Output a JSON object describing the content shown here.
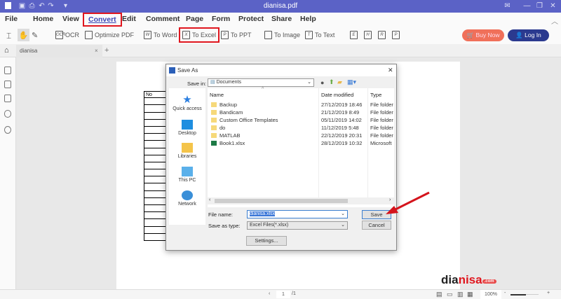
{
  "window": {
    "title": "dianisa.pdf"
  },
  "menu": [
    "File",
    "Home",
    "View",
    "Convert",
    "Edit",
    "Comment",
    "Page",
    "Form",
    "Protect",
    "Share",
    "Help"
  ],
  "toolbar": {
    "ocr": "OCR",
    "optimize": "Optimize PDF",
    "to_word": "To Word",
    "to_excel": "To Excel",
    "to_ppt": "To PPT",
    "to_image": "To Image",
    "to_text": "To Text",
    "extra": [
      "E",
      "H",
      "R",
      "P"
    ],
    "buy_now": "Buy Now",
    "log_in": "Log In"
  },
  "tabs": [
    {
      "label": "dianisa"
    }
  ],
  "document": {
    "table_header": "No"
  },
  "dialog": {
    "title": "Save As",
    "save_in_label": "Save in:",
    "save_in_value": "Documents",
    "places": [
      "Quick access",
      "Desktop",
      "Libraries",
      "This PC",
      "Network"
    ],
    "columns": [
      "Name",
      "Date modified",
      "Type"
    ],
    "files": [
      {
        "name": "Backup",
        "date": "27/12/2019 18:46",
        "type": "File folder",
        "kind": "folder"
      },
      {
        "name": "Bandicam",
        "date": "21/12/2019 8:49",
        "type": "File folder",
        "kind": "folder"
      },
      {
        "name": "Custom Office Templates",
        "date": "05/11/2019 14:02",
        "type": "File folder",
        "kind": "folder"
      },
      {
        "name": "do",
        "date": "11/12/2019 5:48",
        "type": "File folder",
        "kind": "folder"
      },
      {
        "name": "MATLAB",
        "date": "22/12/2019 20:31",
        "type": "File folder",
        "kind": "folder"
      },
      {
        "name": "Book1.xlsx",
        "date": "28/12/2019 10:32",
        "type": "Microsoft",
        "kind": "excel"
      }
    ],
    "file_name_label": "File name:",
    "file_name_value": "dianisa.xlsx",
    "save_type_label": "Save as type:",
    "save_type_value": "Excel Files(*.xlsx)",
    "save": "Save",
    "cancel": "Cancel",
    "settings": "Settings..."
  },
  "status": {
    "page": "1",
    "total": "/1",
    "zoom": "100%"
  },
  "watermark": "dianisa.com",
  "colors": {
    "titlebar": "#5b62c6",
    "buy_now": "#f0705a",
    "log_in": "#2b3a8f",
    "highlight": "#e0161e"
  }
}
